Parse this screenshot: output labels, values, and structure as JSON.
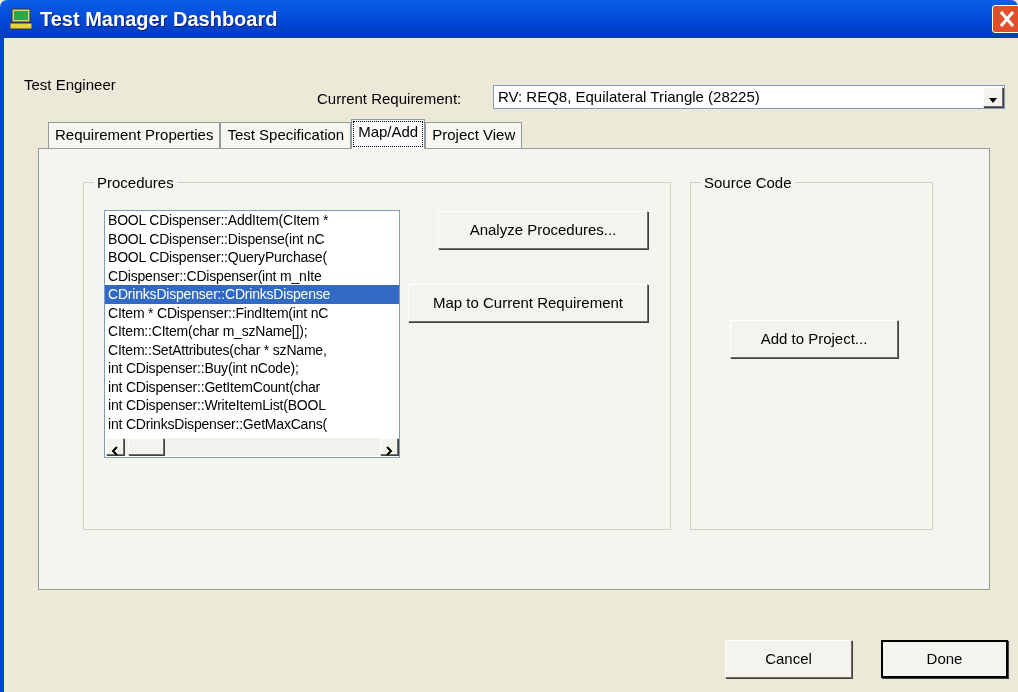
{
  "window": {
    "title": "Test Manager Dashboard"
  },
  "user_label": "Test Engineer",
  "requirement": {
    "label": "Current Requirement:",
    "value": "RV: REQ8, Equilateral Triangle (28225)"
  },
  "tabs": [
    {
      "label": "Requirement Properties",
      "selected": false
    },
    {
      "label": "Test Specification",
      "selected": false
    },
    {
      "label": "Map/Add",
      "selected": true
    },
    {
      "label": "Project View",
      "selected": false
    }
  ],
  "procedures": {
    "title": "Procedures",
    "items": [
      {
        "text": "BOOL CDispenser::AddItem(CItem *",
        "selected": false
      },
      {
        "text": "BOOL CDispenser::Dispense(int nC",
        "selected": false
      },
      {
        "text": "BOOL CDispenser::QueryPurchase(",
        "selected": false
      },
      {
        "text": "CDispenser::CDispenser(int m_nIte",
        "selected": false
      },
      {
        "text": "CDrinksDispenser::CDrinksDispense",
        "selected": true
      },
      {
        "text": "CItem * CDispenser::FindItem(int nC",
        "selected": false
      },
      {
        "text": "CItem::CItem(char m_szName[]);",
        "selected": false
      },
      {
        "text": "CItem::SetAttributes(char * szName,",
        "selected": false
      },
      {
        "text": "int CDispenser::Buy(int nCode);",
        "selected": false
      },
      {
        "text": "int CDispenser::GetItemCount(char",
        "selected": false
      },
      {
        "text": "int CDispenser::WriteItemList(BOOL",
        "selected": false
      },
      {
        "text": "int CDrinksDispenser::GetMaxCans(",
        "selected": false
      }
    ],
    "buttons": [
      "Analyze Procedures...",
      "Map to Current Requirement"
    ]
  },
  "source_code": {
    "title": "Source Code",
    "button": "Add to Project..."
  },
  "buttons": [
    {
      "label": "Cancel",
      "default": false
    },
    {
      "label": "Done",
      "default": true
    }
  ]
}
